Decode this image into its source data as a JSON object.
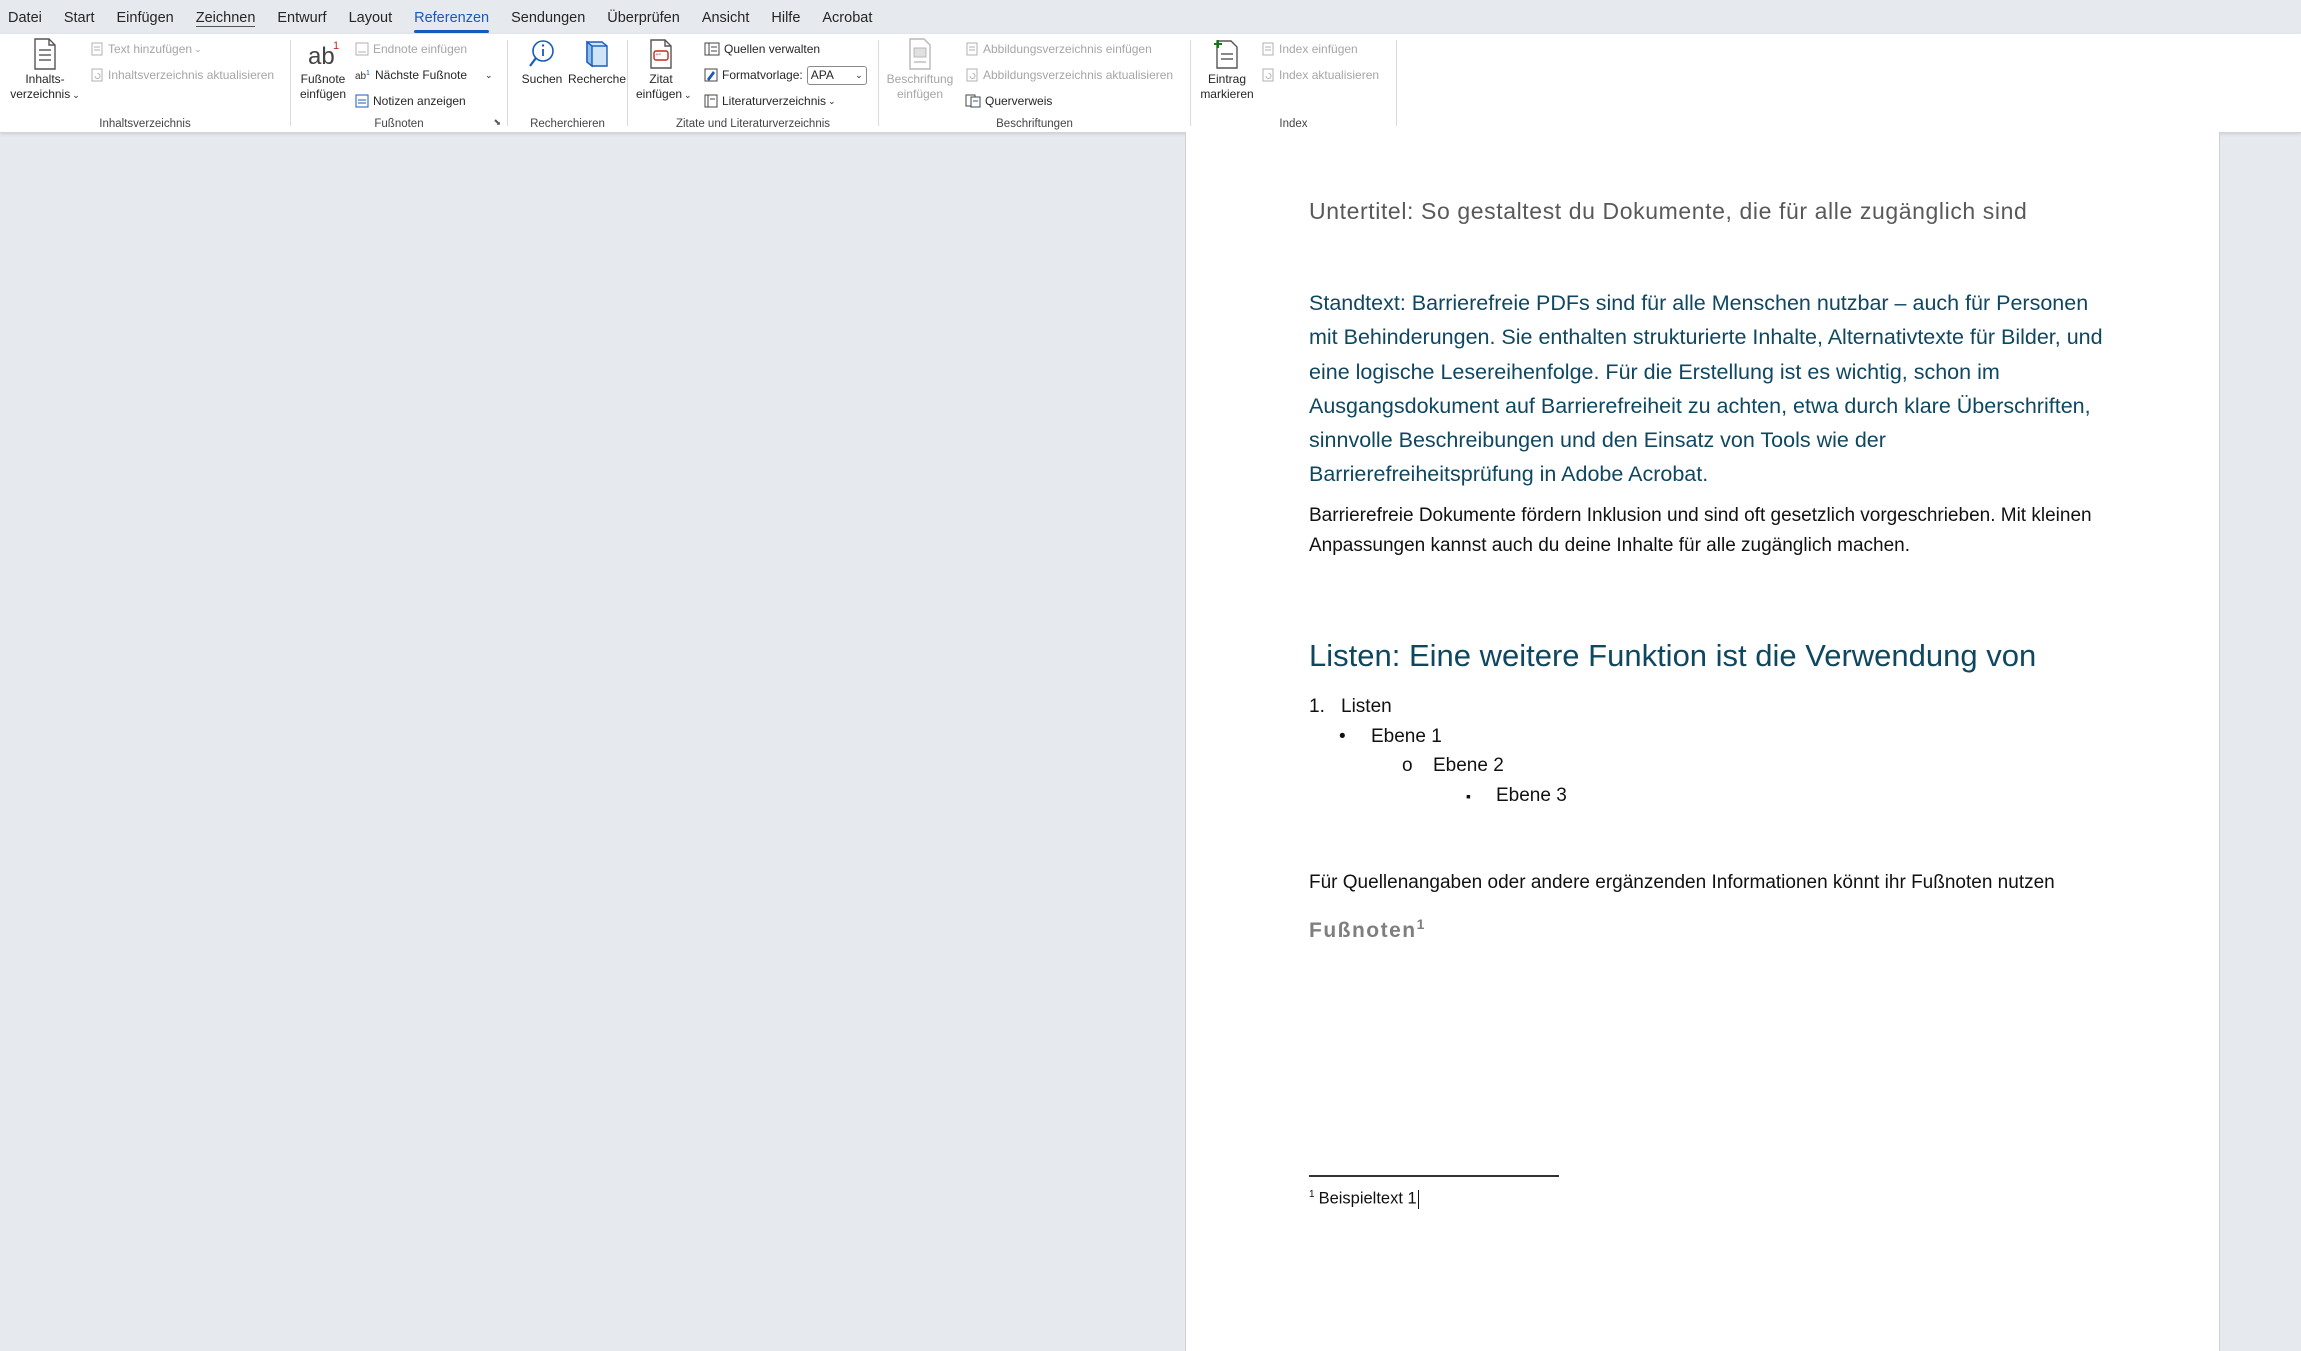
{
  "menu": {
    "tabs": [
      "Datei",
      "Start",
      "Einfügen",
      "Zeichnen",
      "Entwurf",
      "Layout",
      "Referenzen",
      "Sendungen",
      "Überprüfen",
      "Ansicht",
      "Hilfe",
      "Acrobat"
    ],
    "active": "Referenzen"
  },
  "ribbon": {
    "toc": {
      "group_label": "Inhaltsverzeichnis",
      "big_line1": "Inhalts-",
      "big_line2": "verzeichnis",
      "add_text": "Text hinzufügen",
      "update": "Inhaltsverzeichnis aktualisieren"
    },
    "footnotes": {
      "group_label": "Fußnoten",
      "big_line1": "Fußnote",
      "big_line2": "einfügen",
      "endnote": "Endnote einfügen",
      "next": "Nächste Fußnote",
      "show_notes": "Notizen anzeigen"
    },
    "research": {
      "group_label": "Recherchieren",
      "search": "Suchen",
      "research": "Recherche"
    },
    "citations": {
      "group_label": "Zitate und Literaturverzeichnis",
      "big_line1": "Zitat",
      "big_line2": "einfügen",
      "manage_sources": "Quellen verwalten",
      "style_label": "Formatvorlage:",
      "style_value": "APA",
      "bibliography": "Literaturverzeichnis"
    },
    "captions": {
      "group_label": "Beschriftungen",
      "big_line1": "Beschriftung",
      "big_line2": "einfügen",
      "insert_tof": "Abbildungsverzeichnis einfügen",
      "update_tof": "Abbildungsverzeichnis aktualisieren",
      "cross_ref": "Querverweis"
    },
    "index": {
      "group_label": "Index",
      "big_line1": "Eintrag",
      "big_line2": "markieren",
      "insert_index": "Index einfügen",
      "update_index": "Index aktualisieren"
    }
  },
  "document": {
    "subtitle": "Untertitel: So gestaltest du Dokumente, die für alle zugänglich sind",
    "standtext": "Standtext: Barrierefreie PDFs sind für alle Menschen nutzbar – auch für Personen mit Behinderungen. Sie enthalten strukturierte Inhalte, Alternativtexte für Bilder, und eine logische Lesereihenfolge. Für die Erstellung ist es wichtig, schon im Ausgangsdokument auf Barrierefreiheit zu achten, etwa durch klare Überschriften, sinnvolle Beschreibungen und den Einsatz von Tools wie der Barrierefreiheitsprüfung in Adobe Acrobat.",
    "body1": "Barrierefreie Dokumente fördern Inklusion und sind oft gesetzlich vorgeschrieben. Mit kleinen Anpassungen kannst auch du deine Inhalte für alle zugänglich machen.",
    "heading2": "Listen: Eine weitere Funktion ist die Verwendung von",
    "list": [
      {
        "marker": "1.",
        "text": "Listen"
      },
      {
        "marker": "•",
        "text": "Ebene 1"
      },
      {
        "marker": "o",
        "text": "Ebene 2"
      },
      {
        "marker": "▪",
        "text": "Ebene 3"
      }
    ],
    "footnote_intro": "Für Quellenangaben oder andere ergänzenden Informationen könnt ihr Fußnoten nutzen",
    "footnote_heading": "Fußnoten",
    "footnote_ref": "1",
    "footnote_number": "1",
    "footnote_text": "Beispieltext 1"
  }
}
